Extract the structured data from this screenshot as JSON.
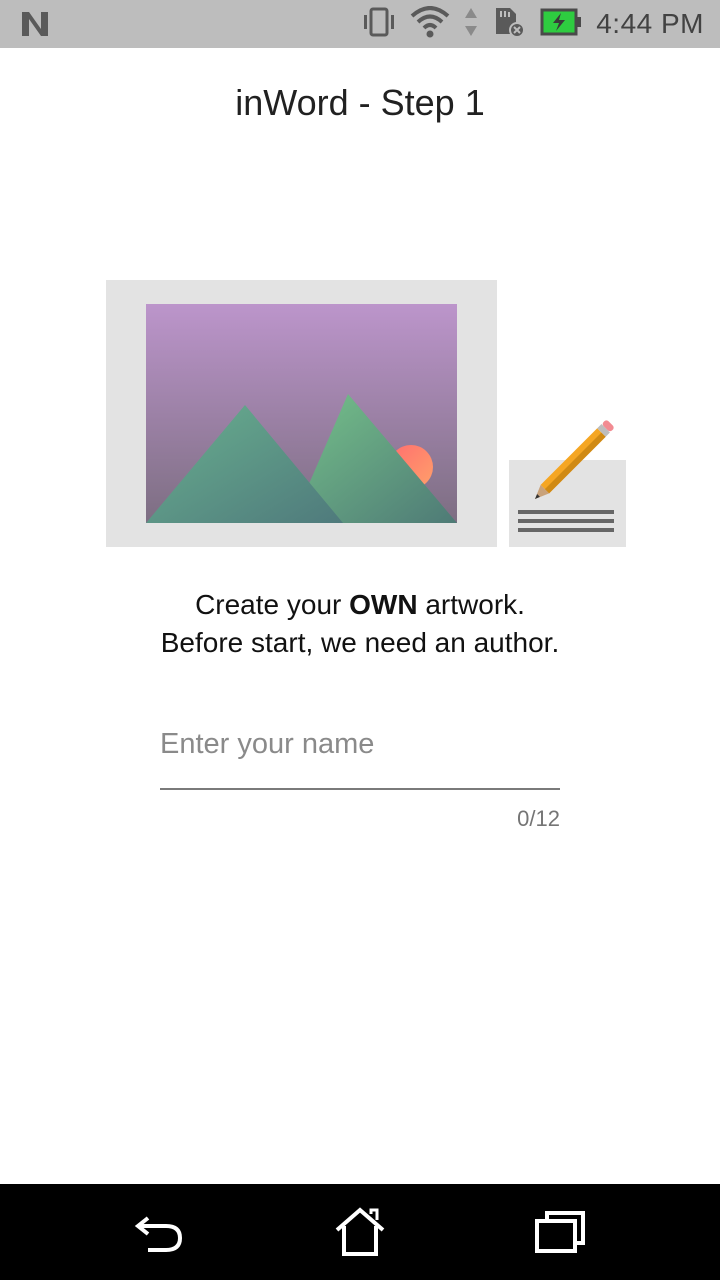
{
  "status_bar": {
    "time": "4:44 PM",
    "icons": [
      "notification-n-icon",
      "vibrate-icon",
      "wifi-icon",
      "data-arrows-icon",
      "sd-card-icon",
      "battery-charging-icon"
    ],
    "battery_color": "#2ecc40"
  },
  "header": {
    "title": "inWord - Step 1"
  },
  "message": {
    "line1_prefix": "Create your ",
    "line1_emphasis": "OWN",
    "line1_suffix": " artwork.",
    "line2": "Before start, we need an author."
  },
  "name_input": {
    "placeholder": "Enter your name",
    "value": "",
    "counter": "0/12"
  },
  "nav_bar": {
    "buttons": [
      "back-icon",
      "home-icon",
      "recents-icon"
    ]
  }
}
